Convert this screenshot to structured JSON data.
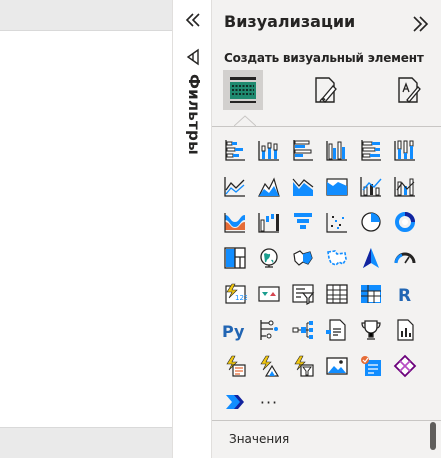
{
  "filters": {
    "label": "Фильтры",
    "collapse_icon": "chevron-double-left-icon",
    "filter_icon": "funnel-icon"
  },
  "visualizations": {
    "title": "Визуализации",
    "expand_icon": "chevron-double-right-icon",
    "subtitle": "Создать визуальный элемент",
    "modes": [
      {
        "name": "build-visual",
        "active": true
      },
      {
        "name": "format-visual",
        "active": false
      },
      {
        "name": "analytics",
        "active": false
      }
    ],
    "icons": [
      "stacked-bar-chart-icon",
      "stacked-column-chart-icon",
      "clustered-bar-chart-icon",
      "clustered-column-chart-icon",
      "100-percent-stacked-bar-chart-icon",
      "100-percent-stacked-column-chart-icon",
      "line-chart-icon",
      "area-chart-icon",
      "stacked-area-chart-icon",
      "line-and-stacked-column-chart-icon",
      "line-and-clustered-column-chart-icon",
      "ribbon-chart-icon",
      "ribbon-chart-alt-icon",
      "waterfall-chart-icon",
      "funnel-chart-icon",
      "scatter-chart-icon",
      "pie-chart-icon",
      "donut-chart-icon",
      "treemap-icon",
      "map-icon",
      "filled-map-icon",
      "shape-map-icon",
      "azure-map-icon",
      "gauge-icon",
      "card-icon",
      "kpi-icon",
      "slicer-icon",
      "table-icon",
      "matrix-icon",
      "r-script-visual-icon",
      "python-visual-icon",
      "key-influencers-icon",
      "decomposition-tree-icon",
      "qna-icon",
      "smart-narrative-icon",
      "paginated-report-icon",
      "power-apps-icon",
      "power-automate-icon",
      "arcgis-map-icon",
      "image-icon",
      "metrics-icon",
      "custom-visual-icon",
      "power-automate-flow-icon",
      "more-visuals-icon"
    ],
    "more_text": "···",
    "values_label": "Значения"
  },
  "colors": {
    "accent_blue": "#118dff",
    "dark_blue": "#12239e",
    "teal": "#1a9e8f",
    "orange": "#e66c37",
    "yellow": "#f2c811",
    "purple": "#6b007b"
  }
}
